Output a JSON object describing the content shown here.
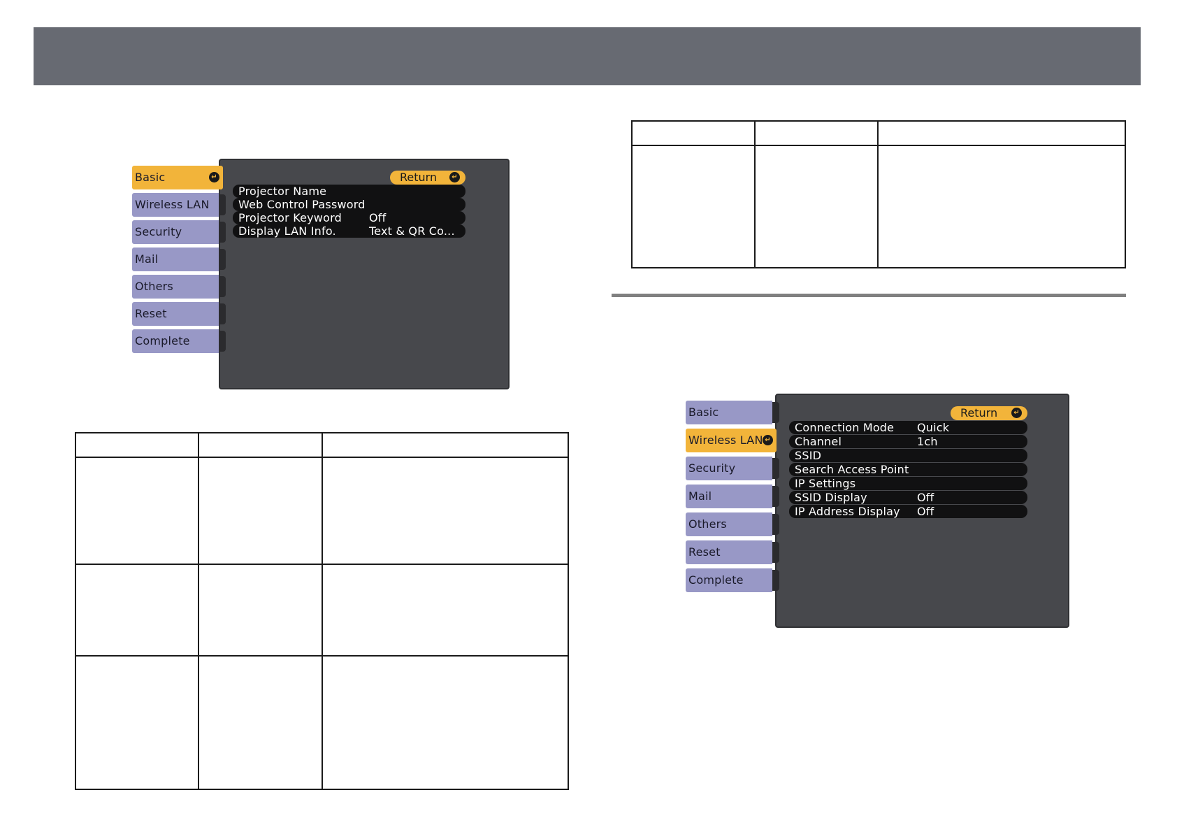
{
  "menu_basic": {
    "tabs": [
      "Basic",
      "Wireless LAN",
      "Security",
      "Mail",
      "Others",
      "Reset",
      "Complete"
    ],
    "active_tab": "Basic",
    "return_label": "Return",
    "rows": [
      {
        "label": "Projector Name",
        "value": ""
      },
      {
        "label": "Web Control Password",
        "value": ""
      },
      {
        "label": "Projector Keyword",
        "value": "Off"
      },
      {
        "label": "Display LAN Info.",
        "value": "Text & QR Co..."
      }
    ]
  },
  "menu_wireless": {
    "tabs": [
      "Basic",
      "Wireless LAN",
      "Security",
      "Mail",
      "Others",
      "Reset",
      "Complete"
    ],
    "active_tab": "Wireless LAN",
    "return_label": "Return",
    "rows": [
      {
        "label": "Connection Mode",
        "value": "Quick"
      },
      {
        "label": "Channel",
        "value": "1ch"
      },
      {
        "label": "SSID",
        "value": ""
      },
      {
        "label": "Search Access Point",
        "value": ""
      },
      {
        "label": "IP Settings",
        "value": ""
      },
      {
        "label": "SSID Display",
        "value": "Off"
      },
      {
        "label": "IP Address Display",
        "value": "Off"
      }
    ]
  },
  "colors": {
    "header": "#676a72",
    "tab": "#9898c6",
    "tab_active": "#f2b43a",
    "panel": "#47484c",
    "row": "#111112"
  }
}
